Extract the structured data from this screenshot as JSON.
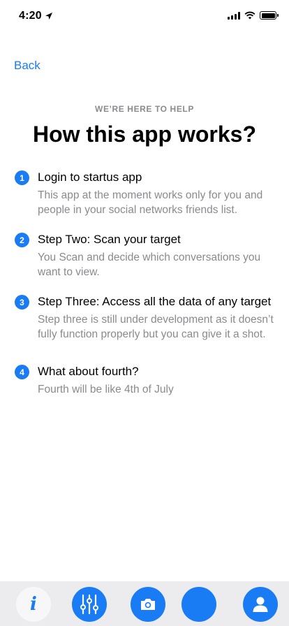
{
  "status_bar": {
    "time": "4:20"
  },
  "nav": {
    "back_label": "Back"
  },
  "header": {
    "eyebrow": "WE’RE HERE TO HELP",
    "title": "How this app works?"
  },
  "steps": [
    {
      "number": "1",
      "title": "Login to startus app",
      "description": "This app at the moment works only for you and people in your social networks friends list."
    },
    {
      "number": "2",
      "title": "Step Two: Scan your target",
      "description": "You Scan and decide which conversations you want to view."
    },
    {
      "number": "3",
      "title": "Step Three: Access all the data of any target",
      "description": "Step three is still under development as it doesn’t fully function properly but you can give it a shot."
    },
    {
      "number": "4",
      "title": "What about fourth?",
      "description": "Fourth will be like 4th of July"
    }
  ],
  "tab_bar": {
    "items": [
      {
        "icon": "info-icon",
        "active": true
      },
      {
        "icon": "sliders-icon"
      },
      {
        "icon": "camera-icon"
      },
      {
        "icon": "blank-icon"
      },
      {
        "icon": "user-icon"
      }
    ]
  },
  "colors": {
    "accent": "#1a7cf5",
    "muted": "#8a8a8f",
    "tab_bar_bg": "#ececee"
  }
}
